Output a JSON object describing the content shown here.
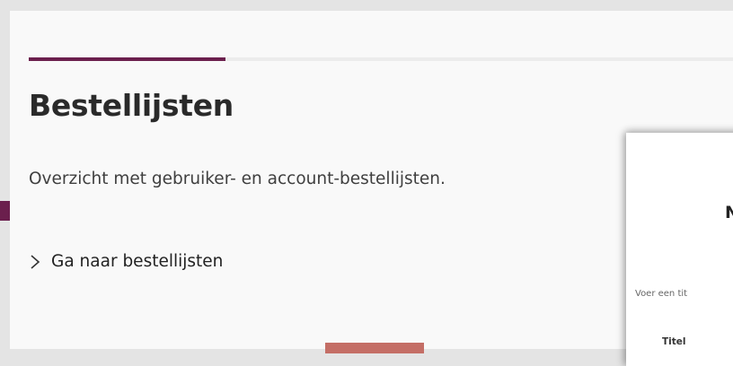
{
  "page": {
    "title": "Bestellijsten",
    "description": "Overzicht met gebruiker- en account-bestellijsten.",
    "goto_link": "Ga naar bestellijsten"
  },
  "modal": {
    "title_partial": "N",
    "description_partial": "Voer een tit",
    "title_field_label": "Titel"
  },
  "colors": {
    "accent": "#6b1f4d",
    "button": "#c46e66"
  }
}
